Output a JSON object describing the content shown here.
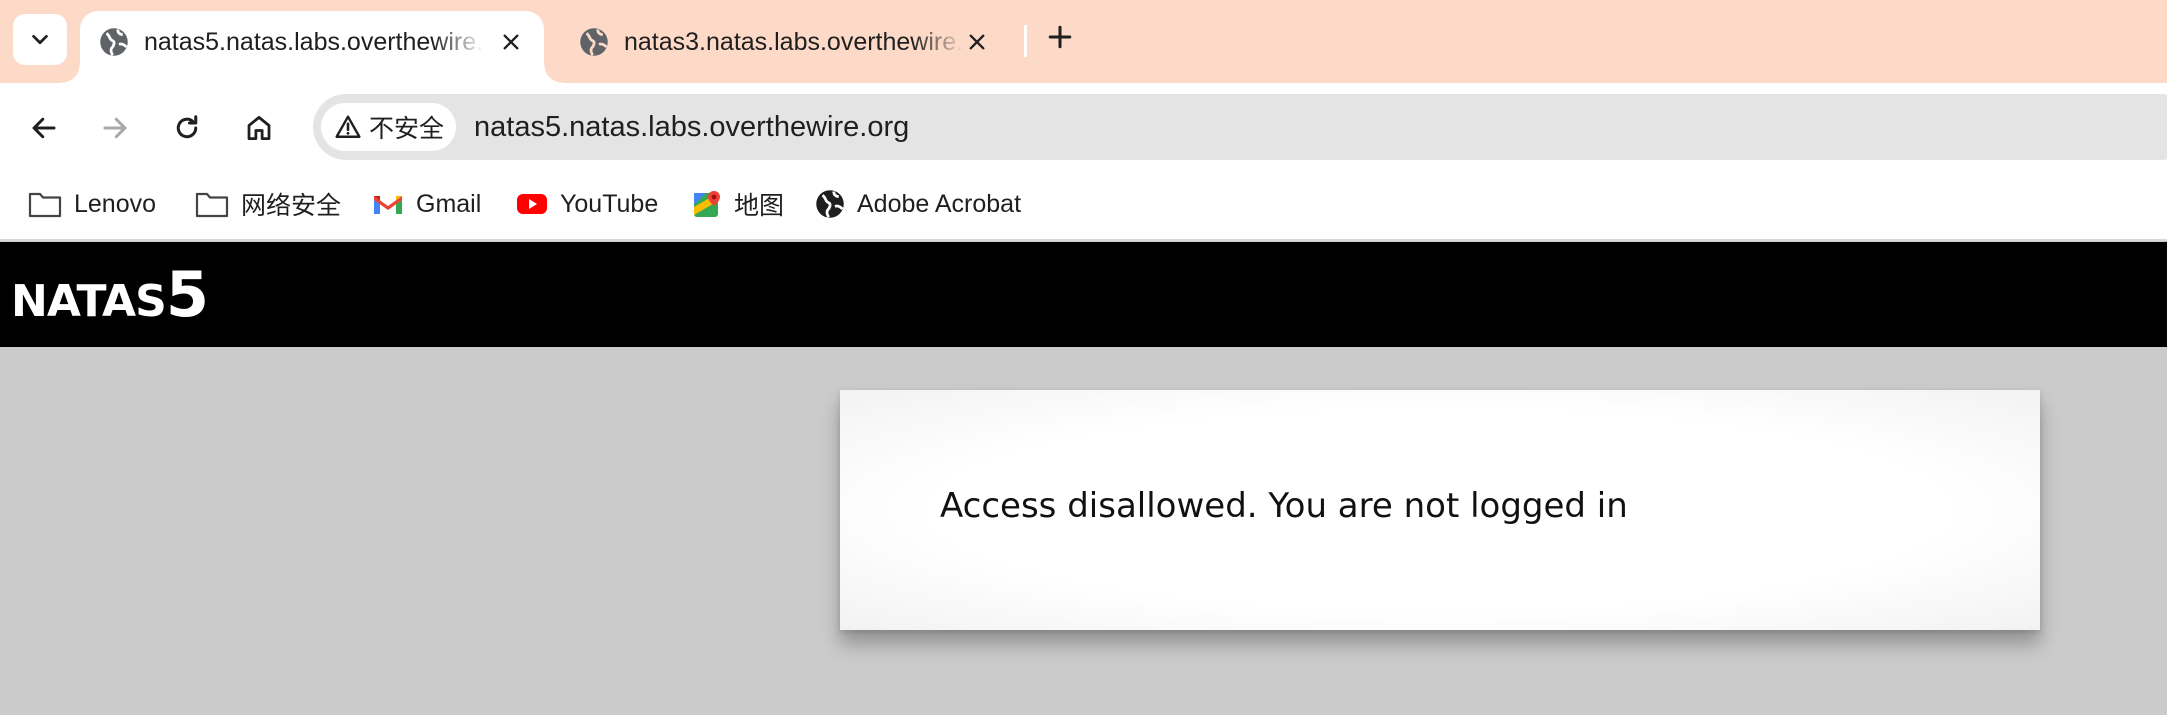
{
  "browser": {
    "tabs": [
      {
        "title": "natas5.natas.labs.overthewire.org",
        "active": true,
        "favicon": "globe-icon"
      },
      {
        "title": "natas3.natas.labs.overthewire.org",
        "active": false,
        "favicon": "globe-icon"
      }
    ],
    "new_tab_icon": "plus-icon",
    "address_bar": {
      "security_label": "不安全",
      "security_icon": "warning-icon",
      "url": "natas5.natas.labs.overthewire.org"
    },
    "bookmarks": [
      {
        "label": "Lenovo",
        "icon": "folder-icon"
      },
      {
        "label": "网络安全",
        "icon": "folder-icon"
      },
      {
        "label": "Gmail",
        "icon": "gmail-icon"
      },
      {
        "label": "YouTube",
        "icon": "youtube-icon"
      },
      {
        "label": "地图",
        "icon": "maps-icon"
      },
      {
        "label": "Adobe Acrobat",
        "icon": "globe-icon"
      }
    ],
    "colors": {
      "tabstrip_bg": "#fddac8",
      "omnibox_bg": "#e4e4e4"
    }
  },
  "page": {
    "site_title_word": "NATAS",
    "site_title_number": "5",
    "message": "Access disallowed. You are not logged in",
    "colors": {
      "header_bg": "#000000",
      "body_bg": "#cbcbcb",
      "card_bg": "#ffffff"
    }
  }
}
